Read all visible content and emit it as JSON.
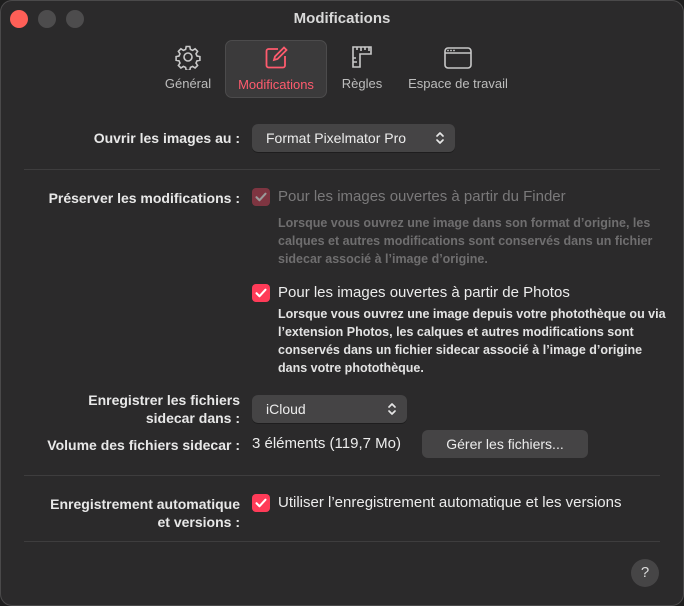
{
  "window": {
    "title": "Modifications"
  },
  "toolbar": {
    "items": [
      {
        "label": "Général",
        "icon": "gear-icon"
      },
      {
        "label": "Modifications",
        "icon": "edit-icon",
        "active": true
      },
      {
        "label": "Règles",
        "icon": "ruler-icon"
      },
      {
        "label": "Espace de travail",
        "icon": "window-icon"
      }
    ]
  },
  "open_images": {
    "label": "Ouvrir les images au :",
    "value": "Format Pixelmator Pro"
  },
  "preserve": {
    "label": "Préserver les modifications :",
    "finder": {
      "checked": true,
      "enabled": false,
      "label": "Pour les images ouvertes à partir du Finder",
      "desc": "Lorsque vous ouvrez une image dans son format d’origine, les calques et autres modifications sont conservés dans un fichier sidecar associé à l’image d’origine."
    },
    "photos": {
      "checked": true,
      "enabled": true,
      "label": "Pour les images ouvertes à partir de Photos",
      "desc": "Lorsque vous ouvrez une image depuis votre photothèque ou via l’extension Photos, les calques et autres modifications sont conservés dans un fichier sidecar associé à l’image d’origine dans votre photothèque."
    }
  },
  "sidecar_location": {
    "label_line1": "Enregistrer les fichiers",
    "label_line2": "sidecar dans :",
    "value": "iCloud"
  },
  "sidecar_volume": {
    "label": "Volume des fichiers sidecar :",
    "value": "3 éléments (119,7 Mo)",
    "button": "Gérer les fichiers..."
  },
  "autosave": {
    "label_line1": "Enregistrement automatique",
    "label_line2": "et versions :",
    "checked": true,
    "option": "Utiliser l’enregistrement automatique et les versions"
  },
  "help": {
    "label": "?"
  },
  "colors": {
    "accent": "#ff3b58",
    "background": "#2b2a2b"
  }
}
